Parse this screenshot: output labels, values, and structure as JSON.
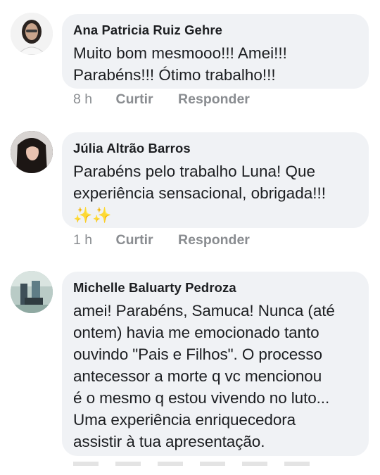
{
  "comments": [
    {
      "author": "Ana Patricia Ruiz Gehre",
      "text": "Muito bom mesmooo!!! Amei!!!\nParabéns!!! Ótimo trabalho!!!",
      "time": "8 h",
      "like_label": "Curtir",
      "reply_label": "Responder",
      "avatar_color": "#6b6f73"
    },
    {
      "author": "Júlia Altrão Barros",
      "text": "Parabéns pelo trabalho Luna! Que\nexperiência sensacional, obrigada!!!",
      "emoji": "✨✨",
      "time": "1 h",
      "like_label": "Curtir",
      "reply_label": "Responder",
      "avatar_color": "#3b2e2a"
    },
    {
      "author": "Michelle Baluarty Pedroza",
      "text": "amei! Parabéns, Samuca! Nunca (até\nontem) havia me emocionado tanto\nouvindo \"Pais e Filhos\". O processo\nantecessor a morte q vc mencionou\né o mesmo q estou vivendo no luto...\nUma experiência enriquecedora\nassistir à tua apresentação.",
      "avatar_color": "#9fb8b2"
    }
  ]
}
